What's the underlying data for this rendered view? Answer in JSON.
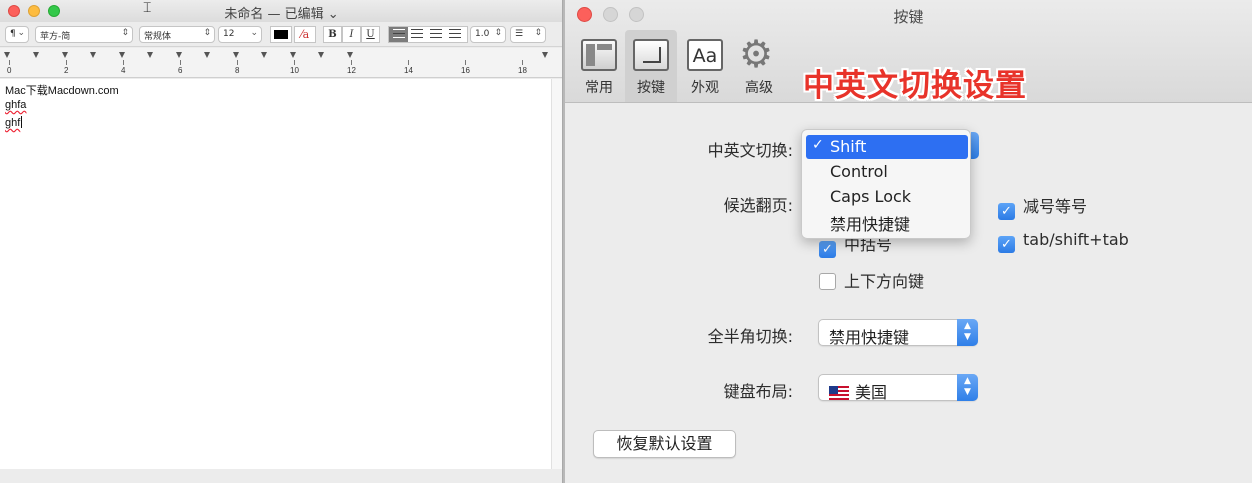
{
  "textedit": {
    "title": "未命名 — 已编辑 ⌄",
    "toolbar": {
      "paragraph_style": "¶",
      "font_family": "苹方-简",
      "font_style": "常规体",
      "font_size": "12",
      "bold": "B",
      "italic": "I",
      "underline": "U",
      "line_spacing": "1.0",
      "list_style": "☰",
      "text_color": "#000000"
    },
    "ruler": {
      "labels": [
        "0",
        "2",
        "4",
        "6",
        "8",
        "10",
        "12",
        "14",
        "16",
        "18"
      ]
    },
    "document": {
      "lines": [
        "Mac下载Macdown.com",
        "ghfa",
        "ghf"
      ]
    }
  },
  "prefs": {
    "title": "按键",
    "tabs": [
      {
        "label": "常用",
        "icon": "window-icon",
        "selected": false
      },
      {
        "label": "按键",
        "icon": "keyboard-key-icon",
        "selected": true
      },
      {
        "label": "外观",
        "icon": "font-aa-icon",
        "selected": false
      },
      {
        "label": "高级",
        "icon": "gear-icon",
        "selected": false
      }
    ],
    "headline": "中英文切换设置",
    "switch_label": "中英文切换:",
    "switch_menu": {
      "selected": "Shift",
      "options": [
        "Shift",
        "Control",
        "Caps Lock",
        "禁用快捷键"
      ]
    },
    "page_label": "候选翻页:",
    "checkboxes": [
      {
        "label": "中括号",
        "checked": true
      },
      {
        "label": "上下方向键",
        "checked": false
      },
      {
        "label": "减号等号",
        "checked": true
      },
      {
        "label": "tab/shift+tab",
        "checked": true
      }
    ],
    "fullwidth_label": "全半角切换:",
    "fullwidth_value": "禁用快捷键",
    "layout_label": "键盘布局:",
    "layout_value": "美国",
    "restore_button": "恢复默认设置"
  },
  "colors": {
    "headline_red": "#e8332a",
    "selection_blue": "#2d6ff2",
    "close_red": "#fc605b",
    "minimize_yellow": "#fdbc40",
    "zoom_green": "#34c84a"
  }
}
